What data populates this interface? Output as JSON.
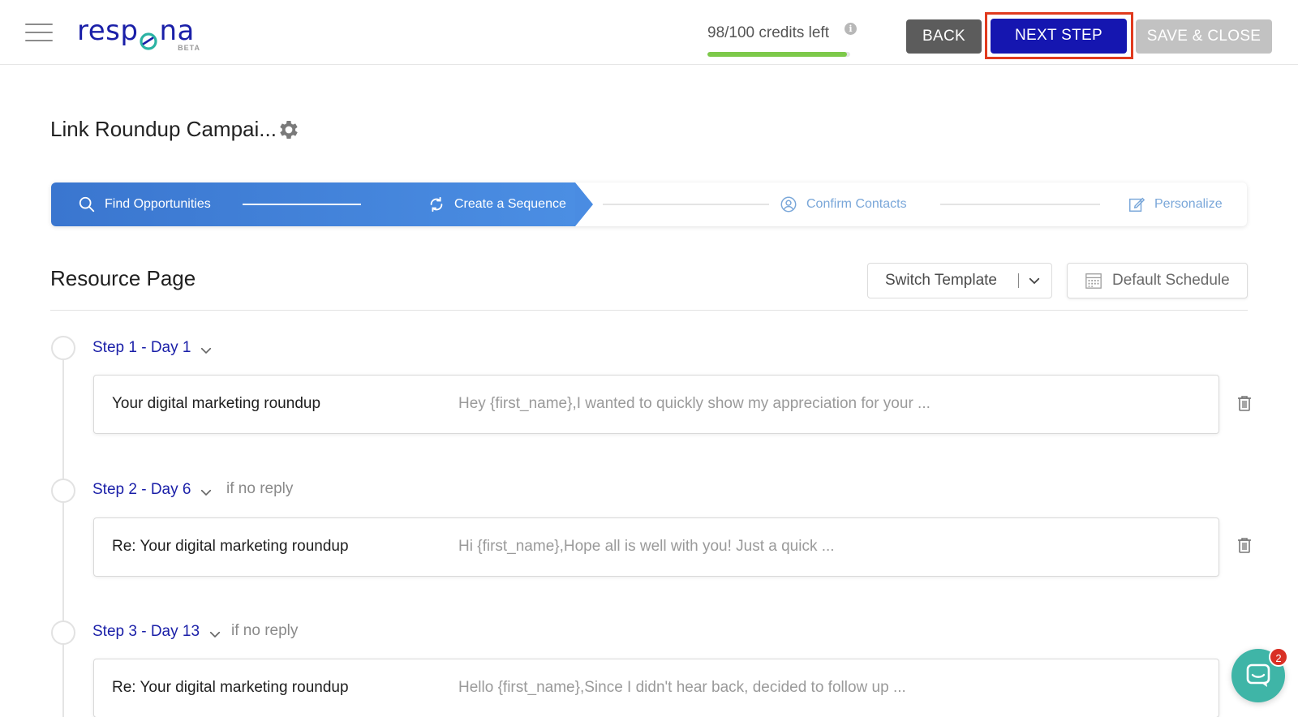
{
  "header": {
    "logo_text_pre": "resp",
    "logo_text_post": "na",
    "logo_beta": "BETA",
    "credits_text": "98/100 credits left",
    "credits_info": "i",
    "credits_progress": 0.98,
    "back_label": "BACK",
    "next_label": "NEXT STEP",
    "save_label": "SAVE & CLOSE"
  },
  "campaign": {
    "title": "Link Roundup Campai..."
  },
  "stepper": {
    "steps": [
      {
        "label": "Find Opportunities",
        "icon": "search-icon",
        "state": "done"
      },
      {
        "label": "Create a Sequence",
        "icon": "refresh-icon",
        "state": "active"
      },
      {
        "label": "Confirm Contacts",
        "icon": "user-circle-icon",
        "state": "pending"
      },
      {
        "label": "Personalize",
        "icon": "edit-icon",
        "state": "pending"
      }
    ]
  },
  "section": {
    "title": "Resource Page",
    "switch_template_label": "Switch Template",
    "default_schedule_label": "Default Schedule"
  },
  "sequence": [
    {
      "step_label": "Step 1 - Day 1",
      "condition": "",
      "subject": "Your digital marketing roundup",
      "preview": "Hey {first_name},I wanted to quickly show my appreciation for your ..."
    },
    {
      "step_label": "Step 2 - Day 6",
      "condition": "if no reply",
      "subject": "Re: Your digital marketing roundup",
      "preview": "Hi {first_name},Hope all is well with you! Just a quick ..."
    },
    {
      "step_label": "Step 3 - Day 13",
      "condition": "if no reply",
      "subject": "Re: Your digital marketing roundup",
      "preview": "Hello {first_name},Since I didn't hear back, decided to follow up ..."
    }
  ],
  "chat": {
    "badge_count": "2"
  },
  "colors": {
    "brand_blue": "#1a1fa8",
    "primary_button": "#1516b0",
    "stepper_active": "#4a8ce2",
    "credits_bar": "#7dc94a",
    "highlight_outline": "#e03a1e",
    "chat_teal": "#3fb5a7"
  }
}
